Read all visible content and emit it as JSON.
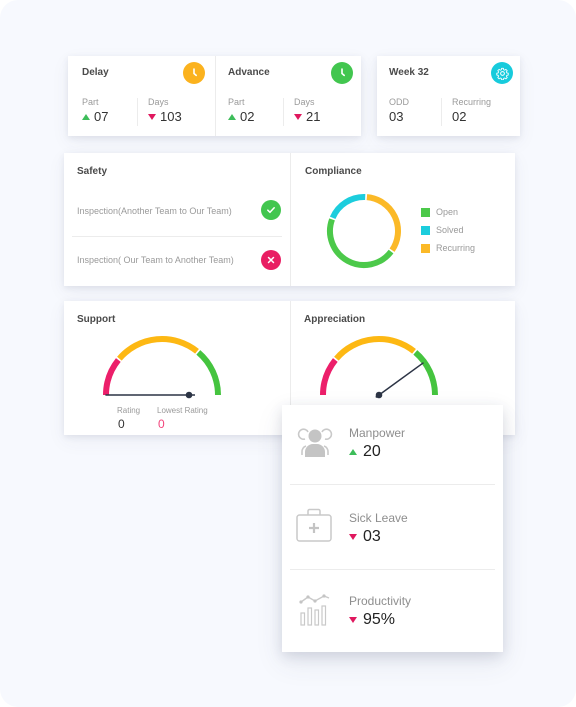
{
  "delay": {
    "title": "Delay",
    "icon": "clock-icon",
    "icon_color": "#fbb21e",
    "part_label": "Part",
    "part_value": "07",
    "part_trend": "up",
    "days_label": "Days",
    "days_value": "103",
    "days_trend": "down"
  },
  "advance": {
    "title": "Advance",
    "icon": "clock-icon",
    "icon_color": "#42c64f",
    "part_label": "Part",
    "part_value": "02",
    "part_trend": "up",
    "days_label": "Days",
    "days_value": "21",
    "days_trend": "down"
  },
  "week": {
    "title": "Week 32",
    "icon": "gear-icon",
    "icon_color": "#17cbdc",
    "odd_label": "ODD",
    "odd_value": "03",
    "recurring_label": "Recurring",
    "recurring_value": "02"
  },
  "safety": {
    "title": "Safety",
    "items": [
      {
        "label": "Inspection(Another Team to Our Team)",
        "status": "pass",
        "icon": "check-icon",
        "color": "#42c64f"
      },
      {
        "label": "Inspection( Our Team to Another Team)",
        "status": "fail",
        "icon": "close-icon",
        "color": "#e91e63"
      }
    ]
  },
  "compliance": {
    "title": "Compliance",
    "legend": [
      {
        "label": "Open",
        "color": "#4cc94a"
      },
      {
        "label": "Solved",
        "color": "#1ccddd"
      },
      {
        "label": "Recurring",
        "color": "#fbb927"
      }
    ]
  },
  "support": {
    "title": "Support",
    "rating_label": "Rating",
    "rating_value": "0",
    "lowest_label": "Lowest Rating",
    "lowest_value": "0",
    "gauge_fraction": 0.0
  },
  "appreciation": {
    "title": "Appreciation",
    "gauge_fraction": 0.8
  },
  "kpis": [
    {
      "label": "Manpower",
      "value": "20",
      "trend": "up",
      "icon": "people-icon"
    },
    {
      "label": "Sick Leave",
      "value": "03",
      "trend": "down",
      "icon": "first-aid-kit-icon"
    },
    {
      "label": "Productivity",
      "value": "95%",
      "trend": "down",
      "icon": "bar-line-chart-icon"
    }
  ],
  "colors": {
    "up": "#3dbd5a",
    "down": "#e0185e",
    "gauge_red": "#ec1f6a",
    "gauge_yellow": "#fdb813",
    "gauge_green": "#45c43f",
    "needle": "#2c3445",
    "lowest_value": "#f2457c"
  },
  "chart_data": [
    {
      "type": "pie",
      "title": "Compliance",
      "style": "donut",
      "categories": [
        "Open",
        "Solved",
        "Recurring"
      ],
      "values": [
        46,
        20,
        34
      ],
      "unit": "percent (estimated)",
      "legend": "right"
    },
    {
      "type": "gauge",
      "title": "Support",
      "bands": [
        "low",
        "medium",
        "high"
      ],
      "value_fraction": 0.0
    },
    {
      "type": "gauge",
      "title": "Appreciation",
      "bands": [
        "low",
        "medium",
        "high"
      ],
      "value_fraction": 0.8
    }
  ]
}
